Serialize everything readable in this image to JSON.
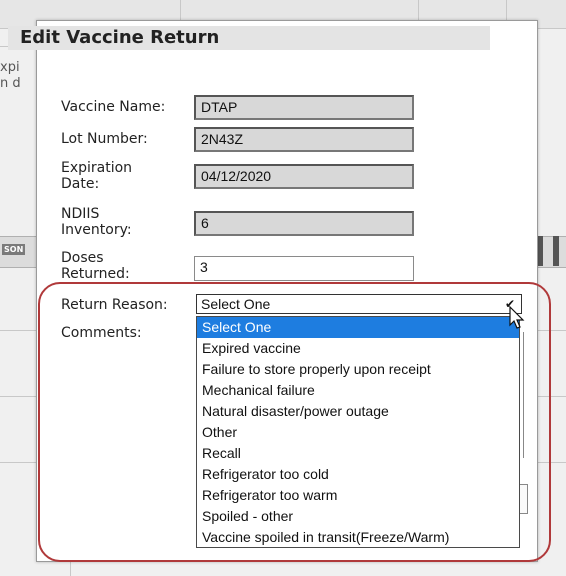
{
  "modal": {
    "title": "Edit Vaccine Return",
    "vaccine_name": {
      "label": "Vaccine Name:",
      "value": "DTAP"
    },
    "lot_number": {
      "label": "Lot Number:",
      "value": "2N43Z"
    },
    "expiration_date": {
      "label_line1": "Expiration",
      "label_line2": "Date:",
      "value": "04/12/2020"
    },
    "ndiis_inventory": {
      "label_line1": "NDIIS",
      "label_line2": "Inventory:",
      "value": "6"
    },
    "doses_returned": {
      "label_line1": "Doses",
      "label_line2": "Returned:",
      "value": "3"
    },
    "return_reason": {
      "label": "Return Reason:",
      "selected": "Select One",
      "options": [
        "Select One",
        "Expired vaccine",
        "Failure to store properly upon receipt",
        "Mechanical failure",
        "Natural disaster/power outage",
        "Other",
        "Recall",
        "Refrigerator too cold",
        "Refrigerator too warm",
        "Spoiled - other",
        "Vaccine spoiled in transit(Freeze/Warm)"
      ]
    },
    "comments": {
      "label": "Comments:"
    }
  },
  "background": {
    "left_text_1": "xpi",
    "left_text_2": "n d",
    "band_label": "SON"
  },
  "colors": {
    "selected_option": "#1e7de0",
    "highlight_ring": "#b0393a",
    "readonly_field": "#d8d8d8"
  }
}
